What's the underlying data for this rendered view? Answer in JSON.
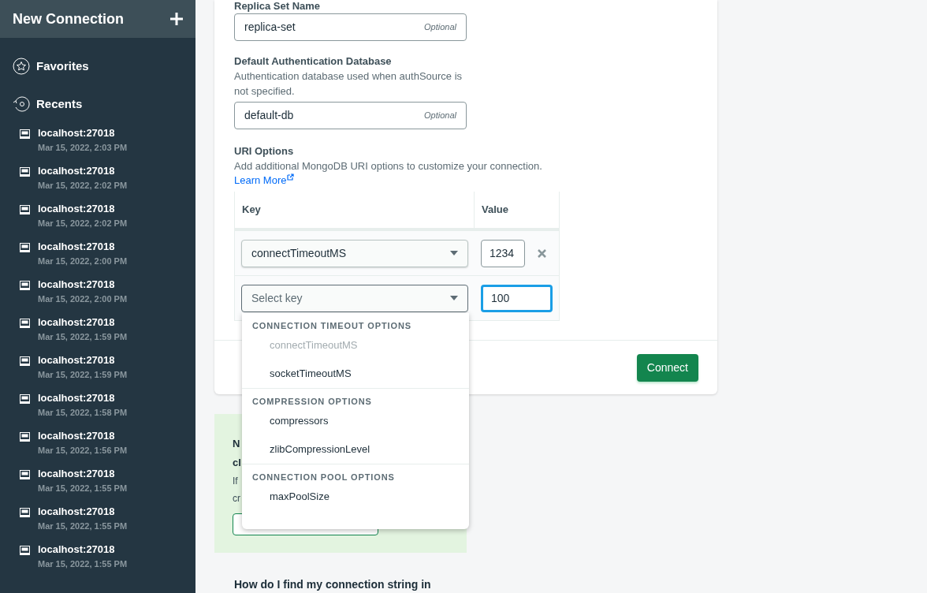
{
  "sidebar": {
    "new_connection": "New Connection",
    "favorites": "Favorites",
    "recents_label": "Recents",
    "recents": [
      {
        "host": "localhost:27018",
        "time": "Mar 15, 2022, 2:03 PM"
      },
      {
        "host": "localhost:27018",
        "time": "Mar 15, 2022, 2:02 PM"
      },
      {
        "host": "localhost:27018",
        "time": "Mar 15, 2022, 2:02 PM"
      },
      {
        "host": "localhost:27018",
        "time": "Mar 15, 2022, 2:00 PM"
      },
      {
        "host": "localhost:27018",
        "time": "Mar 15, 2022, 2:00 PM"
      },
      {
        "host": "localhost:27018",
        "time": "Mar 15, 2022, 1:59 PM"
      },
      {
        "host": "localhost:27018",
        "time": "Mar 15, 2022, 1:59 PM"
      },
      {
        "host": "localhost:27018",
        "time": "Mar 15, 2022, 1:58 PM"
      },
      {
        "host": "localhost:27018",
        "time": "Mar 15, 2022, 1:56 PM"
      },
      {
        "host": "localhost:27018",
        "time": "Mar 15, 2022, 1:55 PM"
      },
      {
        "host": "localhost:27018",
        "time": "Mar 15, 2022, 1:55 PM"
      },
      {
        "host": "localhost:27018",
        "time": "Mar 15, 2022, 1:55 PM"
      }
    ]
  },
  "form": {
    "replica_set": {
      "label": "Replica Set Name",
      "value": "replica-set",
      "hint": "Optional"
    },
    "auth_db": {
      "label": "Default Authentication Database",
      "description": "Authentication database used when authSource is not specified.",
      "value": "default-db",
      "hint": "Optional"
    },
    "uri_options": {
      "label": "URI Options",
      "description": "Add additional MongoDB URI options to customize your connection.",
      "link": "Learn More",
      "columns": [
        "Key",
        "Value"
      ],
      "rows": [
        {
          "key": "connectTimeoutMS",
          "value": "1234",
          "removable": true,
          "focused": false
        },
        {
          "key_placeholder": "Select key",
          "value": "100",
          "removable": false,
          "focused": true
        }
      ]
    },
    "connect_button": "Connect"
  },
  "dropdown": {
    "groups": [
      {
        "title": "CONNECTION TIMEOUT OPTIONS",
        "items": [
          {
            "label": "connectTimeoutMS",
            "disabled": true
          },
          {
            "label": "socketTimeoutMS",
            "disabled": false
          }
        ]
      },
      {
        "title": "COMPRESSION OPTIONS",
        "items": [
          {
            "label": "compressors",
            "disabled": false
          },
          {
            "label": "zlibCompressionLevel",
            "disabled": false
          }
        ]
      },
      {
        "title": "CONNECTION POOL OPTIONS",
        "items": [
          {
            "label": "maxPoolSize",
            "disabled": false
          }
        ]
      }
    ]
  },
  "help": {
    "title_lines": [
      "N",
      "cl"
    ],
    "body_lines": [
      "If",
      "cr"
    ],
    "question": "How do I find my connection string in"
  }
}
